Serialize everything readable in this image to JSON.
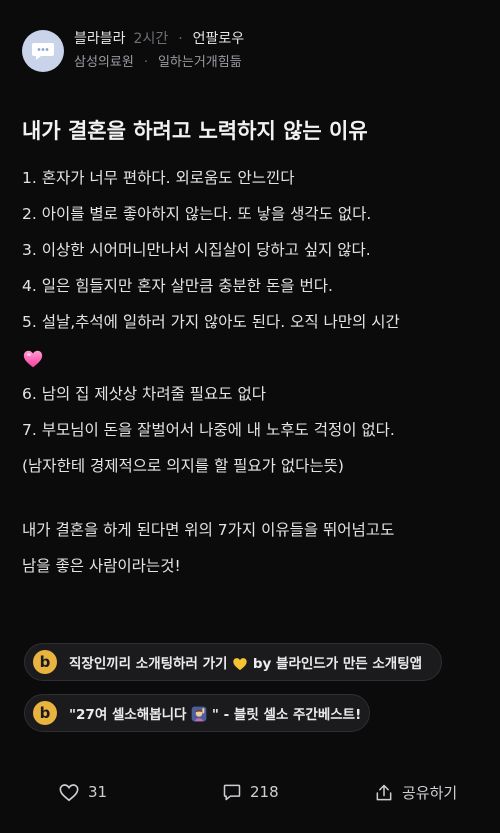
{
  "header": {
    "author": "블라블라",
    "time": "2시간",
    "separator": "·",
    "follow_label": "언팔로우",
    "company": "삼성의료원",
    "board": "일하는거개힘듦"
  },
  "post": {
    "title": "내가 결혼을 하려고 노력하지 않는 이유",
    "lines": [
      "1. 혼자가 너무 편하다. 외로움도 안느낀다",
      "2. 아이를 별로 좋아하지 않는다. 또 낳을 생각도 없다.",
      "3. 이상한 시어머니만나서 시집살이 당하고 싶지 않다.",
      "4. 일은 힘들지만 혼자 살만큼 충분한 돈을 번다.",
      "5. 설날,추석에 일하러 가지 않아도 된다. 오직 나만의 시간",
      "6. 남의 집 제삿상 차려줄 필요도 없다",
      "7. 부모님이 돈을 잘벌어서 나중에 내 노후도 걱정이 없다.",
      "(남자한테 경제적으로 의지를 할 필요가 없다는뜻)"
    ],
    "closing": [
      "내가 결혼을 하게 된다면 위의 7가지 이유들을 뛰어넘고도",
      "남을 좋은 사람이라는것!"
    ]
  },
  "links": [
    {
      "icon": "b",
      "text_before": "직장인끼리 소개팅하러 가기",
      "text_after": " by 블라인드가 만든 소개팅앱"
    },
    {
      "icon": "b",
      "text_before": "\"27여 셀소해봅니다",
      "text_after": "\" - 블릿 셀소 주간베스트!"
    }
  ],
  "footer": {
    "likes": "31",
    "comments": "218",
    "share_label": "공유하기"
  },
  "colors": {
    "background": "#0b0b0c",
    "avatar_bg": "#c9d3ea",
    "link_icon": "#e9b340"
  }
}
